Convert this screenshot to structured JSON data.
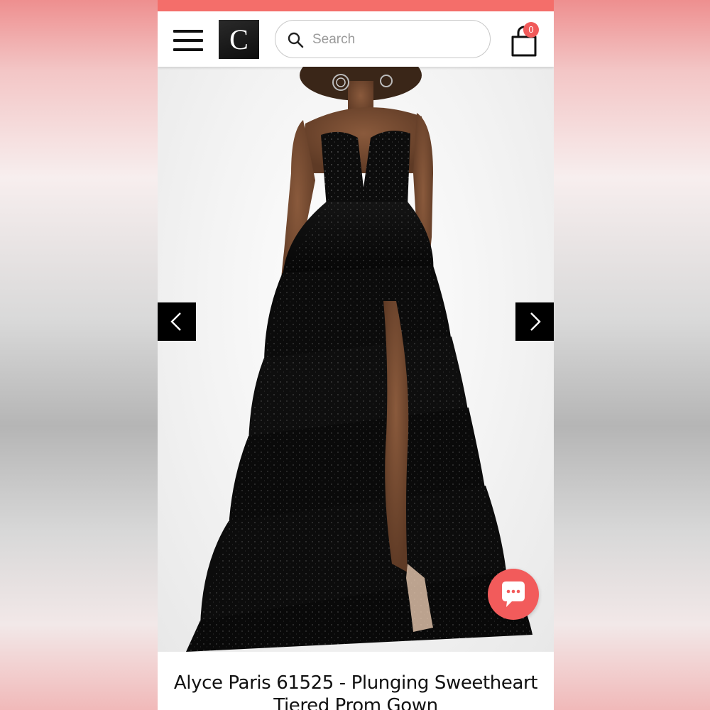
{
  "header": {
    "logo_letter": "C",
    "search_placeholder": "Search",
    "cart_count": "0"
  },
  "icons": {
    "menu": "hamburger-icon",
    "search": "magnifier-icon",
    "cart": "shopping-bag-icon",
    "prev": "chevron-left-icon",
    "next": "chevron-right-icon",
    "chat": "chat-bubble-icon"
  },
  "colors": {
    "accent": "#f46e6a",
    "badge": "#f05a5a",
    "chat_button": "#f25b5b"
  },
  "product": {
    "title_line1": "Alyce Paris 61525 - Plunging Sweetheart",
    "title_line2": "Tiered Prom Gown"
  }
}
